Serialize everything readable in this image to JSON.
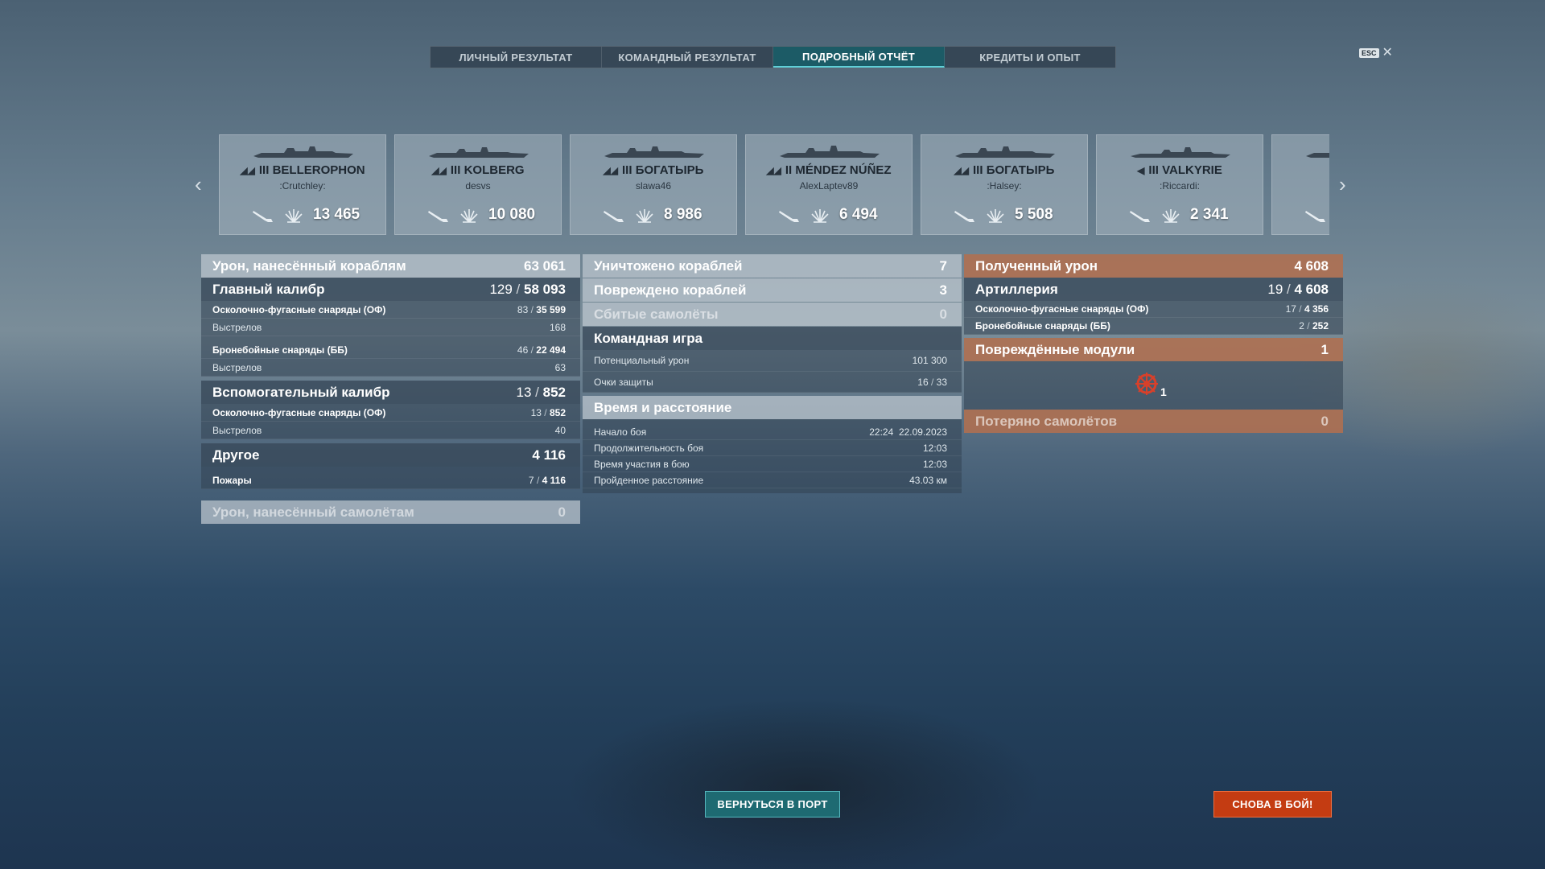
{
  "tabs": [
    {
      "label": "ЛИЧНЫЙ РЕЗУЛЬТАТ",
      "active": false
    },
    {
      "label": "КОМАНДНЫЙ РЕЗУЛЬТАТ",
      "active": false
    },
    {
      "label": "ПОДРОБНЫЙ ОТЧЁТ",
      "active": true
    },
    {
      "label": "КРЕДИТЫ И ОПЫТ",
      "active": false
    }
  ],
  "close": {
    "key": "ESC",
    "icon": "close-icon"
  },
  "ships": [
    {
      "tier": "III",
      "name": "BELLEROPHON",
      "player": ":Crutchley:",
      "damage": "13 465"
    },
    {
      "tier": "III",
      "name": "KOLBERG",
      "player": "desvs",
      "damage": "10 080"
    },
    {
      "tier": "III",
      "name": "БОГАТЫРЬ",
      "player": "slawa46",
      "damage": "8 986"
    },
    {
      "tier": "II",
      "name": "MÉNDEZ NÚÑEZ",
      "player": "AlexLaptev89",
      "damage": "6 494"
    },
    {
      "tier": "III",
      "name": "БОГАТЫРЬ",
      "player": ":Halsey:",
      "damage": "5 508"
    },
    {
      "tier": "III",
      "name": "VALKYRIE",
      "player": ":Riccardi:",
      "damage": "2 341"
    }
  ],
  "left": {
    "ship_damage": {
      "label": "Урон, нанесённый кораблям",
      "value": "63 061"
    },
    "main_battery": {
      "label": "Главный калибр",
      "hits": "129",
      "damage": "58 093"
    },
    "mb_he": {
      "label": "Осколочно-фугасные снаряды (ОФ)",
      "hits": "83",
      "damage": "35 599"
    },
    "mb_he_shots": {
      "label": "Выстрелов",
      "value": "168"
    },
    "mb_ap": {
      "label": "Бронебойные снаряды (ББ)",
      "hits": "46",
      "damage": "22 494"
    },
    "mb_ap_shots": {
      "label": "Выстрелов",
      "value": "63"
    },
    "secondary": {
      "label": "Вспомогательный калибр",
      "hits": "13",
      "damage": "852"
    },
    "sec_he": {
      "label": "Осколочно-фугасные снаряды (ОФ)",
      "hits": "13",
      "damage": "852"
    },
    "sec_he_shots": {
      "label": "Выстрелов",
      "value": "40"
    },
    "other": {
      "label": "Другое",
      "value": "4 116"
    },
    "fires": {
      "label": "Пожары",
      "count": "7",
      "damage": "4 116"
    },
    "aircraft_damage": {
      "label": "Урон, нанесённый самолётам",
      "value": "0"
    }
  },
  "middle": {
    "destroyed": {
      "label": "Уничтожено кораблей",
      "value": "7"
    },
    "damaged": {
      "label": "Повреждено кораблей",
      "value": "3"
    },
    "planes": {
      "label": "Сбитые самолёты",
      "value": "0"
    },
    "team": {
      "label": "Командная игра"
    },
    "potential": {
      "label": "Потенциальный урон",
      "value": "101 300"
    },
    "defense": {
      "label": "Очки защиты",
      "a": "16",
      "b": "33"
    },
    "time": {
      "label": "Время и расстояние"
    },
    "start": {
      "label": "Начало боя",
      "time": "22:24",
      "date": "22.09.2023"
    },
    "duration": {
      "label": "Продолжительность боя",
      "value": "12:03"
    },
    "participation": {
      "label": "Время участия в бою",
      "value": "12:03"
    },
    "distance": {
      "label": "Пройденное расстояние",
      "value": "43.03 км"
    }
  },
  "right": {
    "received": {
      "label": "Полученный урон",
      "value": "4 608"
    },
    "artillery": {
      "label": "Артиллерия",
      "hits": "19",
      "damage": "4 608"
    },
    "he": {
      "label": "Осколочно-фугасные снаряды (ОФ)",
      "hits": "17",
      "damage": "4 356"
    },
    "ap": {
      "label": "Бронебойные снаряды (ББ)",
      "hits": "2",
      "damage": "252"
    },
    "modules": {
      "label": "Повреждённые модули",
      "value": "1"
    },
    "module_item": {
      "icon": "steering-wheel-icon",
      "count": "1"
    },
    "lost_planes": {
      "label": "Потеряно самолётов",
      "value": "0"
    }
  },
  "buttons": {
    "port": "ВЕРНУТЬСЯ В ПОРТ",
    "battle": "СНОВА В БОЙ!"
  }
}
